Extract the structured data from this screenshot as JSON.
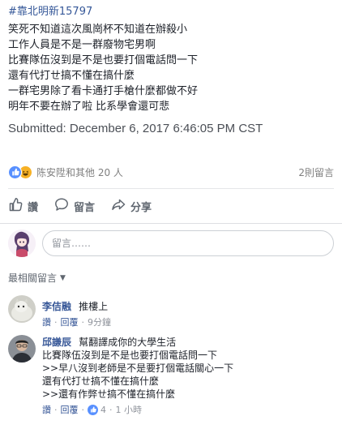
{
  "post": {
    "hashtag": "#靠北明新15797",
    "lines": [
      "笑死不知道這次風崗杯不知道在辦殺小",
      "工作人員是不是一群廢物宅男啊",
      "比賽隊伍沒到是不是也要打個電話問一下",
      "還有代打ㄝ搞不懂在搞什麼",
      "一群宅男除了看卡通打手槍什麼都做不好",
      "明年不要在辦了啦 比系學會還可悲"
    ],
    "submitted": "Submitted: December 6, 2017 6:46:05 PM CST"
  },
  "reactions": {
    "names": "陈安陞和其他 20 人",
    "comment_count": "2則留言"
  },
  "actions": {
    "like": "讚",
    "comment": "留言",
    "share": "分享"
  },
  "composer": {
    "placeholder": "留言……"
  },
  "filter": {
    "label": "最相關留言"
  },
  "comments": [
    {
      "author": "李佶融",
      "text": "推樓上",
      "lines": [],
      "like": "讚",
      "reply": "回覆",
      "time": "9分鐘",
      "likes": ""
    },
    {
      "author": "邱謙辰",
      "text": "幫翻譯成你的大學生活",
      "lines": [
        "比賽隊伍沒到是不是也要打個電話問一下",
        ">>早八沒到老師是不是要打個電話關心一下",
        "還有代打ㄝ搞不懂在搞什麼",
        ">>還有作弊ㄝ搞不懂在搞什麼"
      ],
      "like": "讚",
      "reply": "回覆",
      "time": "1 小時",
      "likes": "4"
    }
  ],
  "colors": {
    "link": "#385898",
    "like_blue": "#5890ff",
    "haha_yellow": "#f7b125",
    "meta_gray": "#90949c"
  }
}
